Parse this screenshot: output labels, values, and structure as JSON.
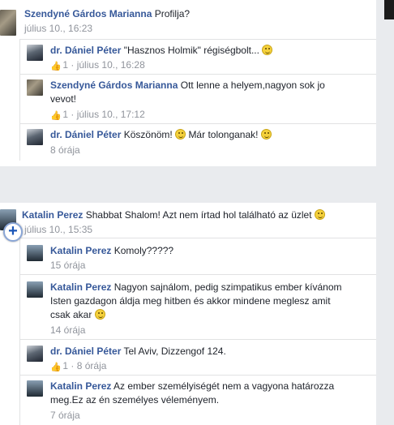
{
  "thread1": {
    "comment": {
      "author": "Szendyné Gárdos Marianna",
      "text": "Profilja?",
      "time": "július 10., 16:23"
    },
    "replies": [
      {
        "author": "dr. Dániel Péter",
        "text": "\"Hasznos Holmik\" régiségbolt...",
        "likes": "1",
        "time": "július 10., 16:28"
      },
      {
        "author": "Szendyné Gárdos Marianna",
        "text_line1": "Ott lenne a helyem,nagyon sok jo",
        "text_line2": "vevot!",
        "likes": "1",
        "time": "július 10., 17:12"
      },
      {
        "author": "dr. Dániel Péter",
        "text_a": "Köszönöm!",
        "text_b": "Már tolonganak!",
        "time": "8 órája"
      }
    ]
  },
  "thread2": {
    "comment": {
      "author": "Katalin Perez",
      "text": "Shabbat Shalom! Azt nem írtad hol található az üzlet",
      "time": "július 10., 15:35"
    },
    "replies": [
      {
        "author": "Katalin Perez",
        "text": "Komoly?????",
        "time": "15 órája"
      },
      {
        "author": "Katalin Perez",
        "text_line1": "Nagyon sajnálom, pedig szimpatikus ember kívánom",
        "text_line2": "Isten gazdagon áldja meg hitben és akkor mindene meglesz amit",
        "text_line3": "csak akar",
        "time": "14 órája"
      },
      {
        "author": "dr. Dániel Péter",
        "text": "Tel Aviv, Dizzengof 124.",
        "likes": "1",
        "time": "8 órája"
      },
      {
        "author": "Katalin Perez",
        "text_line1": "Az ember személyiségét nem a vagyona határozza",
        "text_line2": "meg.Ez az én személyes véleményem.",
        "time": "7 órája"
      }
    ]
  },
  "ui": {
    "like_icon": "thumbs-up-icon",
    "smiley_icon": "smiley-emoji-icon",
    "zoom_icon": "zoom-in-plus-icon",
    "zoom_symbol": "+",
    "dot": "·"
  }
}
